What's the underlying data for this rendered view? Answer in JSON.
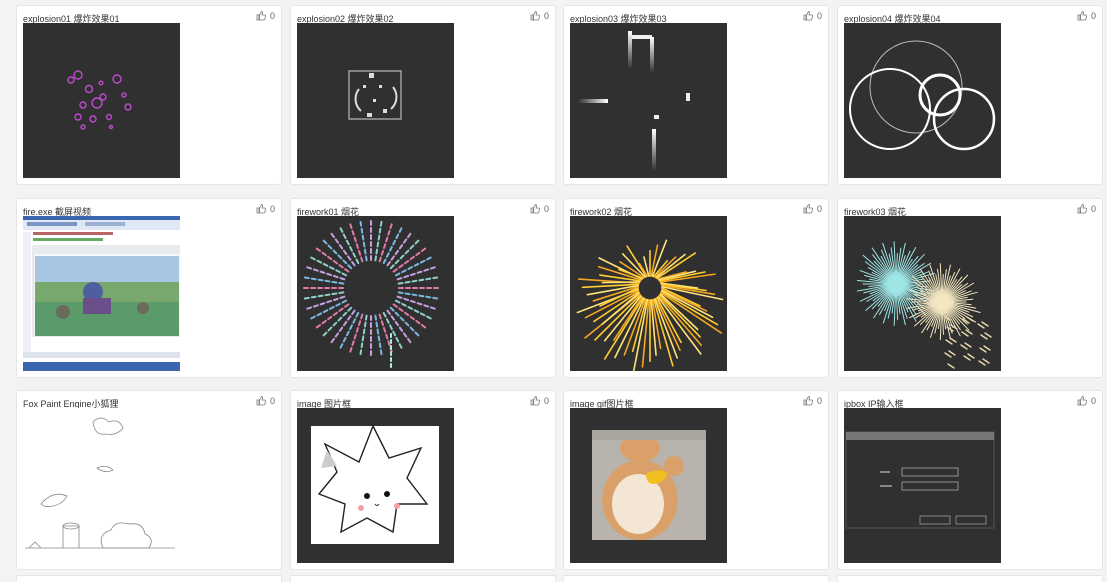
{
  "cards": [
    {
      "title": "explosion01 爆炸效果01",
      "likes": "0"
    },
    {
      "title": "explosion02 爆炸效果02",
      "likes": "0"
    },
    {
      "title": "explosion03 爆炸效果03",
      "likes": "0"
    },
    {
      "title": "explosion04 爆炸效果04",
      "likes": "0"
    },
    {
      "title": "fire.exe 截屏视频",
      "likes": "0"
    },
    {
      "title": "firework01 烟花",
      "likes": "0"
    },
    {
      "title": "firework02 烟花",
      "likes": "0"
    },
    {
      "title": "firework03 烟花",
      "likes": "0"
    },
    {
      "title": "Fox Paint Engine小狐狸",
      "likes": "0"
    },
    {
      "title": "image 图片框",
      "likes": "0"
    },
    {
      "title": "image gif图片框",
      "likes": "0"
    },
    {
      "title": "ipbox IP输入框",
      "likes": "0"
    }
  ],
  "colors": {
    "page_bg": "#f2f3f5",
    "card_bg": "#ffffff",
    "thumb_bg": "#303030",
    "title_text": "#333333",
    "like_text": "#666666"
  },
  "icons": {
    "like": "thumbs-up-icon"
  }
}
